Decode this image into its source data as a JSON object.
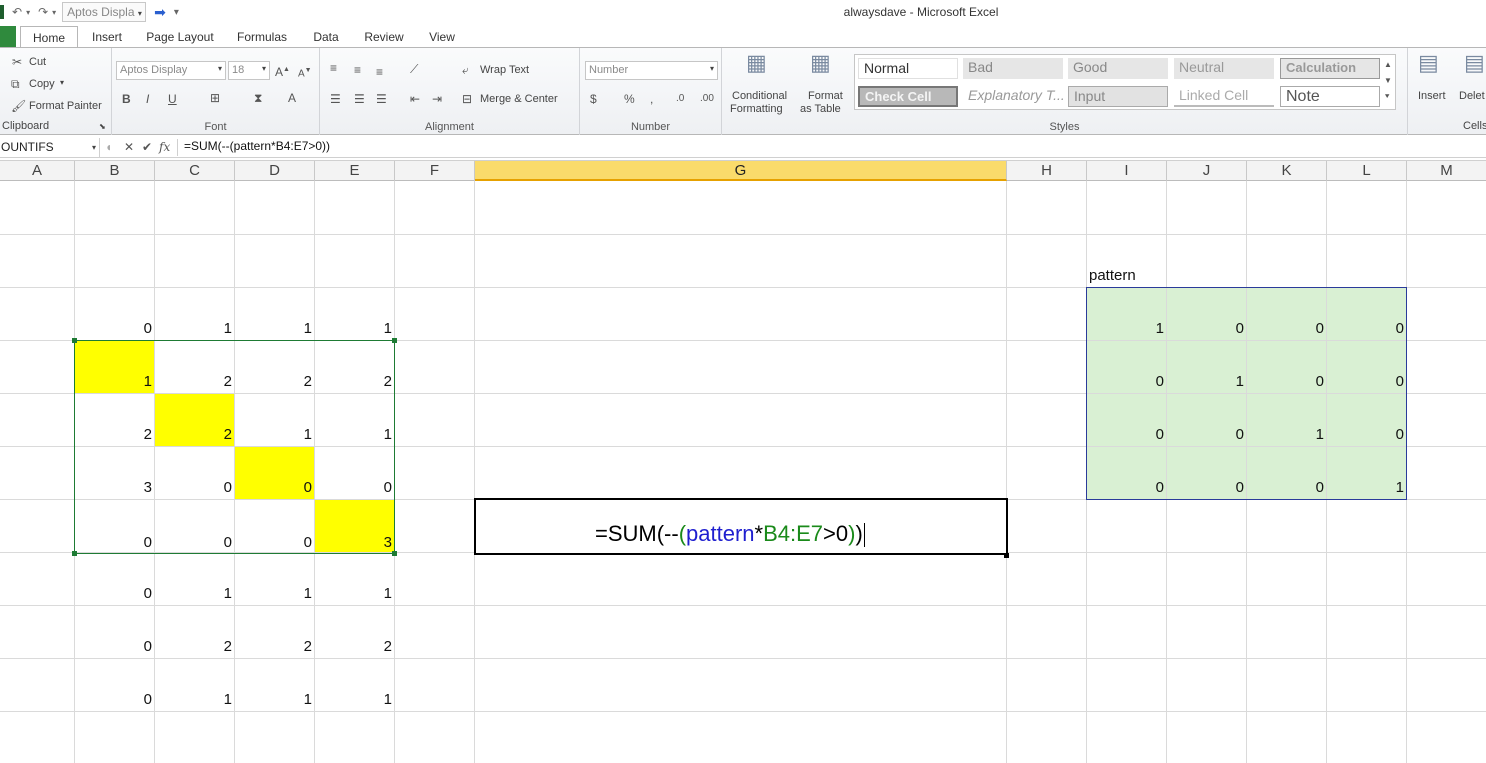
{
  "window": {
    "title": "alwaysdave  -  Microsoft Excel"
  },
  "qat": {
    "font_name": "Aptos Displa"
  },
  "tabs": [
    "Home",
    "Insert",
    "Page Layout",
    "Formulas",
    "Data",
    "Review",
    "View"
  ],
  "ribbon": {
    "clipboard": {
      "label": "Clipboard",
      "cut": "Cut",
      "copy": "Copy",
      "format_painter": "Format Painter"
    },
    "font": {
      "label": "Font",
      "name": "Aptos Display",
      "size": "18"
    },
    "alignment": {
      "label": "Alignment",
      "wrap_text": "Wrap Text",
      "merge_center": "Merge & Center"
    },
    "number": {
      "label": "Number",
      "format": "Number"
    },
    "styles": {
      "label": "Styles",
      "conditional": [
        "Conditional",
        "Formatting"
      ],
      "format_table": [
        "Format",
        "as Table"
      ],
      "cells": [
        "Normal",
        "Bad",
        "Good",
        "Neutral",
        "Calculation",
        "Check Cell",
        "Explanatory T...",
        "Input",
        "Linked Cell",
        "Note"
      ]
    },
    "cells": {
      "label": "Cells",
      "insert": "Insert",
      "delete": "Delet"
    }
  },
  "formula_bar": {
    "name_box": "OUNTIFS",
    "fx": "fx",
    "formula": "=SUM(--(pattern*B4:E7>0))"
  },
  "columns": [
    "A",
    "B",
    "C",
    "D",
    "E",
    "F",
    "G",
    "H",
    "I",
    "J",
    "K",
    "L",
    "M"
  ],
  "selected_column": "G",
  "left_block": [
    [
      "0",
      "1",
      "1",
      "1"
    ],
    [
      "1",
      "2",
      "2",
      "2"
    ],
    [
      "2",
      "2",
      "1",
      "1"
    ],
    [
      "3",
      "0",
      "0",
      "0"
    ],
    [
      "0",
      "0",
      "0",
      "3"
    ],
    [
      "0",
      "1",
      "1",
      "1"
    ],
    [
      "0",
      "2",
      "2",
      "2"
    ],
    [
      "0",
      "1",
      "1",
      "1"
    ]
  ],
  "pattern": {
    "label": "pattern",
    "rows": [
      [
        "1",
        "0",
        "0",
        "0"
      ],
      [
        "0",
        "1",
        "0",
        "0"
      ],
      [
        "0",
        "0",
        "1",
        "0"
      ],
      [
        "0",
        "0",
        "0",
        "1"
      ]
    ]
  },
  "edit_cell": {
    "p1": "=SUM(--",
    "p2": "(",
    "p3": "pattern",
    "p4": "*",
    "p5": "B4:E7",
    "p6": ">0",
    "p7": ")",
    "p8": ")"
  },
  "colors": {
    "highlight": "#ffff00",
    "pattern_fill": "#d9f0d3",
    "selected_header": "#fadb6b",
    "file_tab": "#2f8a3d",
    "ref_blue": "#1f1fcf",
    "ref_green": "#1a8a1a"
  }
}
